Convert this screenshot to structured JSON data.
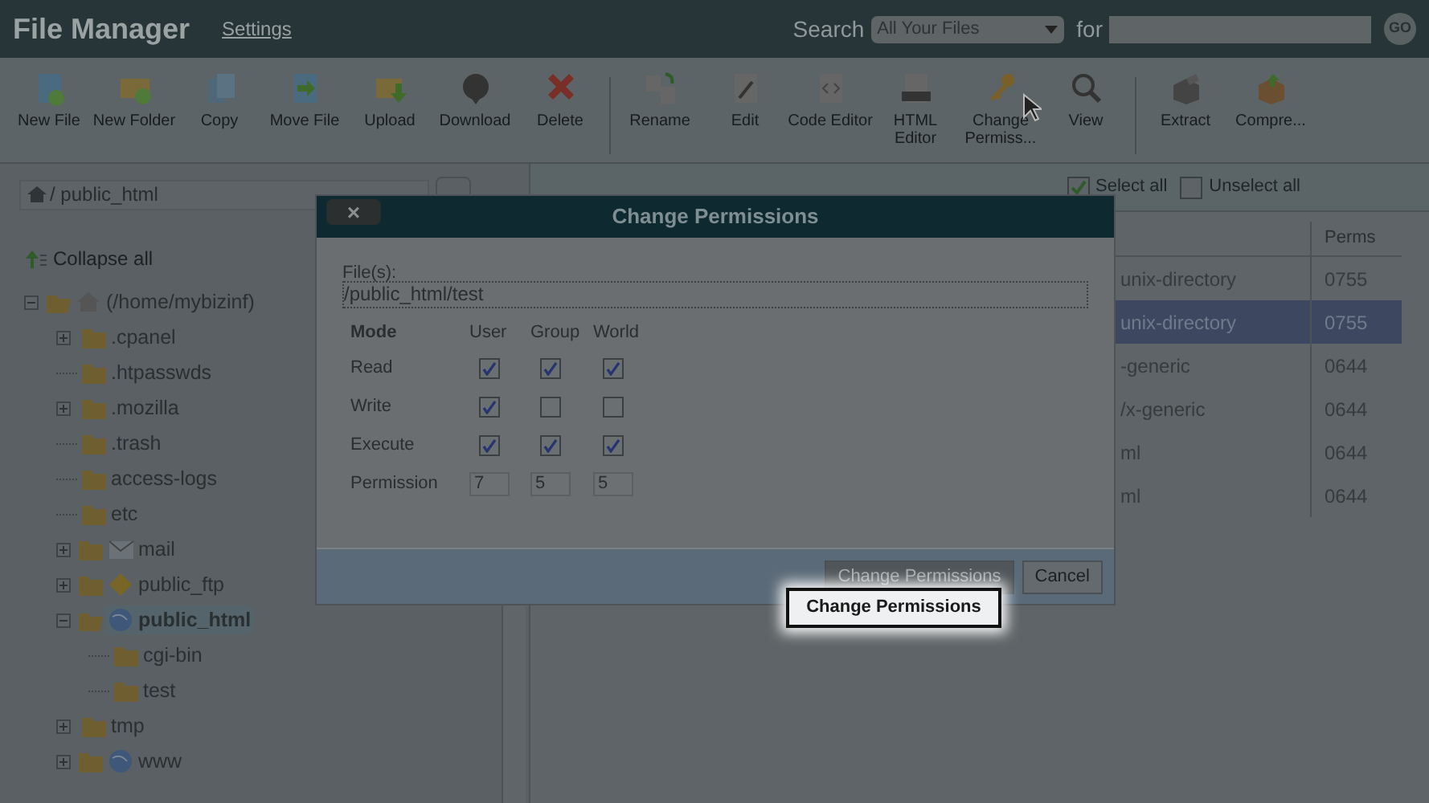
{
  "header": {
    "title": "File Manager",
    "settings_link": "Settings",
    "search_label": "Search",
    "search_scope": "All Your Files",
    "for_label": "for",
    "go_button": "GO"
  },
  "toolbar": [
    [
      {
        "label": "New File",
        "kind": "newfile"
      },
      {
        "label": "New Folder",
        "kind": "newfolder"
      },
      {
        "label": "Copy",
        "kind": "copy"
      },
      {
        "label": "Move File",
        "kind": "move"
      },
      {
        "label": "Upload",
        "kind": "upload"
      },
      {
        "label": "Download",
        "kind": "download"
      },
      {
        "label": "Delete",
        "kind": "delete"
      }
    ],
    [
      {
        "label": "Rename",
        "kind": "rename"
      },
      {
        "label": "Edit",
        "kind": "edit"
      },
      {
        "label": "Code Editor",
        "kind": "code"
      },
      {
        "label": "HTML Editor",
        "kind": "html"
      },
      {
        "label": "Change Permiss...",
        "kind": "key"
      },
      {
        "label": "View",
        "kind": "view"
      }
    ],
    [
      {
        "label": "Extract",
        "kind": "extract"
      },
      {
        "label": "Compre...",
        "kind": "compress"
      }
    ]
  ],
  "path_bar": {
    "value": "/ public_html"
  },
  "collapse_all": "Collapse all",
  "tree": [
    {
      "label": "(/home/mybizinf)",
      "kind": "home",
      "expanded": true,
      "selected": false,
      "children": [
        {
          "label": ".cpanel",
          "kind": "folder",
          "expanded": false,
          "selected": false
        },
        {
          "label": ".htpasswds",
          "kind": "folder",
          "selected": false
        },
        {
          "label": ".mozilla",
          "kind": "folder",
          "expanded": false,
          "selected": false
        },
        {
          "label": ".trash",
          "kind": "folder",
          "selected": false
        },
        {
          "label": "access-logs",
          "kind": "folder",
          "selected": false
        },
        {
          "label": "etc",
          "kind": "folder",
          "selected": false
        },
        {
          "label": "mail",
          "kind": "mail",
          "expanded": false,
          "selected": false
        },
        {
          "label": "public_ftp",
          "kind": "ftp",
          "expanded": false,
          "selected": false
        },
        {
          "label": "public_html",
          "kind": "globe",
          "expanded": true,
          "selected": true,
          "children": [
            {
              "label": "cgi-bin",
              "kind": "folder",
              "selected": false
            },
            {
              "label": "test",
              "kind": "folder",
              "selected": false
            }
          ]
        },
        {
          "label": "tmp",
          "kind": "folder",
          "expanded": false,
          "selected": false
        },
        {
          "label": "www",
          "kind": "globe",
          "expanded": false,
          "selected": false
        }
      ]
    }
  ],
  "file_toolbar": [
    {
      "label": "Select all",
      "checked": true
    },
    {
      "label": "Unselect all",
      "checked": false
    }
  ],
  "table": {
    "columns": [
      "Perms"
    ],
    "rows": [
      {
        "type": "unix-directory",
        "perms": "0755",
        "selected": false
      },
      {
        "type": "unix-directory",
        "perms": "0755",
        "selected": true
      },
      {
        "type": "-generic",
        "perms": "0644",
        "selected": false
      },
      {
        "type": "/x-generic",
        "perms": "0644",
        "selected": false
      },
      {
        "type": "ml",
        "perms": "0644",
        "selected": false
      },
      {
        "type": "ml",
        "perms": "0644",
        "selected": false
      }
    ]
  },
  "dialog": {
    "title": "Change Permissions",
    "close": "×",
    "files_label": "File(s):",
    "files_value": "/public_html/test",
    "columns": [
      "Mode",
      "User",
      "Group",
      "World"
    ],
    "rows": [
      {
        "label": "Read",
        "checks": [
          true,
          true,
          true
        ]
      },
      {
        "label": "Write",
        "checks": [
          true,
          false,
          false
        ]
      },
      {
        "label": "Execute",
        "checks": [
          true,
          true,
          true
        ]
      }
    ],
    "permission": {
      "label": "Permission",
      "values": [
        "7",
        "5",
        "5"
      ]
    },
    "buttons": [
      {
        "label": "Change Permissions",
        "disabled": true
      },
      {
        "label": "Cancel",
        "disabled": false
      }
    ]
  },
  "highlighted_button": "Change Permissions"
}
